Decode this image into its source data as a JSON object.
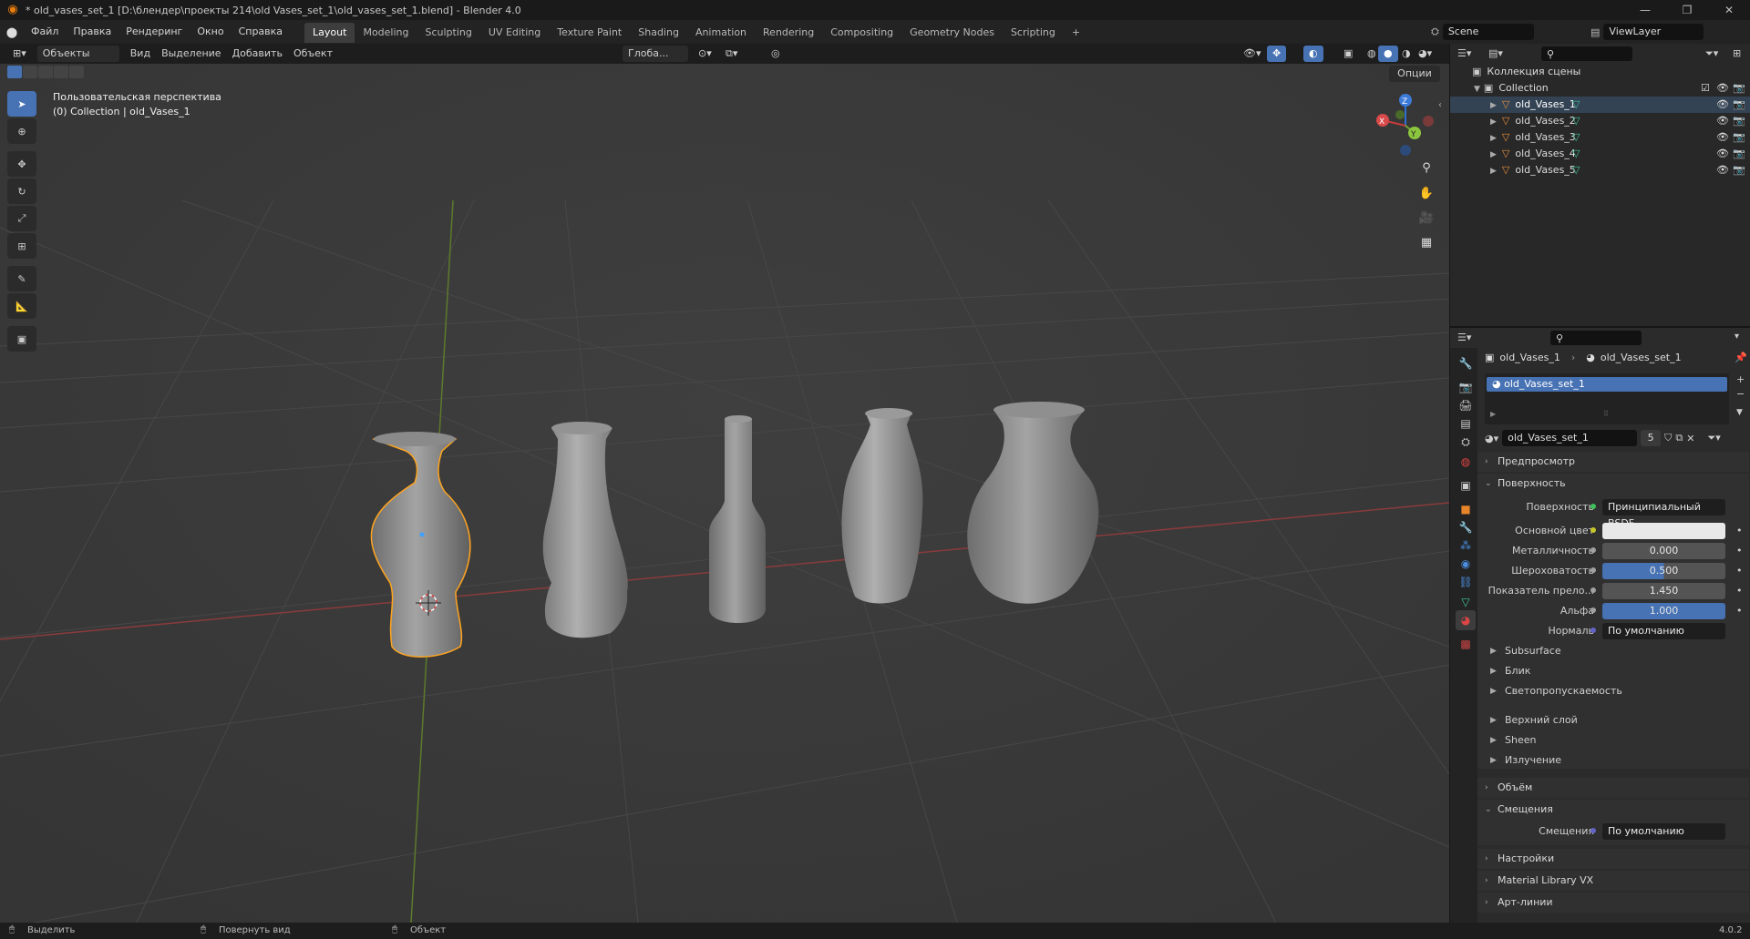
{
  "window": {
    "title": "* old_vases_set_1 [D:\\блендер\\проекты 214\\old Vases_set_1\\old_vases_set_1.blend] - Blender 4.0",
    "minimize": "—",
    "maximize": "❐",
    "close": "✕"
  },
  "menu": {
    "items": [
      "Файл",
      "Правка",
      "Рендеринг",
      "Окно",
      "Справка"
    ],
    "workspaces": [
      "Layout",
      "Modeling",
      "Sculpting",
      "UV Editing",
      "Texture Paint",
      "Shading",
      "Animation",
      "Rendering",
      "Compositing",
      "Geometry Nodes",
      "Scripting"
    ],
    "active_workspace": "Layout",
    "add_tab": "+",
    "scene": "Scene",
    "view_layer": "ViewLayer"
  },
  "viewport_header": {
    "mode": "Объекты",
    "menus": [
      "Вид",
      "Выделение",
      "Добавить",
      "Объект"
    ],
    "transform": "Глоба...",
    "options": "Опции"
  },
  "viewport": {
    "view_name": "Пользовательская перспектива",
    "collection_info": "(0) Collection | old_Vases_1",
    "gizmo": {
      "x": "X",
      "y": "Y",
      "z": "Z"
    }
  },
  "outliner": {
    "root": "Коллекция сцены",
    "collection": "Collection",
    "objects": [
      "old_Vases_1",
      "old_Vases_2",
      "old_Vases_3",
      "old_Vases_4",
      "old_Vases_5"
    ]
  },
  "properties": {
    "breadcrumb": {
      "object": "old_Vases_1",
      "material": "old_Vases_set_1"
    },
    "material_slot": "old_Vases_set_1",
    "material_name": "old_Vases_set_1",
    "user_count": "5",
    "panels": {
      "preview": "Предпросмотр",
      "surface": "Поверхность",
      "volume": "Объём",
      "displacement": "Смещения",
      "settings": "Настройки",
      "material_library": "Material Library VX",
      "lineart": "Арт-линии"
    },
    "surface_rows": [
      {
        "label": "Поверхность",
        "value": "Принципиальный BSDF"
      },
      {
        "label": "Основной цвет",
        "value": ""
      },
      {
        "label": "Металличность",
        "value": "0.000"
      },
      {
        "label": "Шероховатость",
        "value": "0.500"
      },
      {
        "label": "Показатель прело...",
        "value": "1.450"
      },
      {
        "label": "Альфа",
        "value": "1.000"
      },
      {
        "label": "Нормаль",
        "value": "По умолчанию"
      }
    ],
    "subpanels": [
      "Subsurface",
      "Блик",
      "Светопропускаемость",
      "Верхний слой",
      "Sheen",
      "Излучение"
    ],
    "displacement_row": {
      "label": "Смещения",
      "value": "По умолчанию"
    }
  },
  "status": {
    "select": "Выделить",
    "rotate": "Повернуть вид",
    "object": "Объект",
    "version": "4.0.2"
  }
}
